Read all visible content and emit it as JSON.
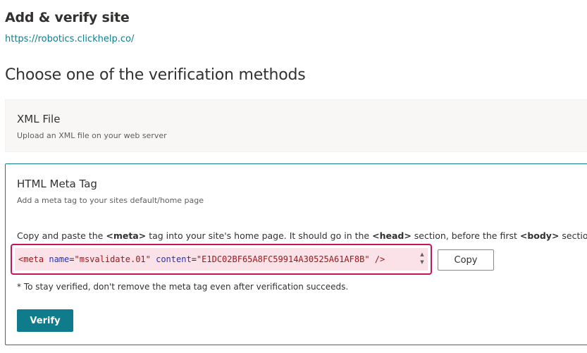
{
  "header": {
    "title": "Add & verify site",
    "site_url": "https://robotics.clickhelp.co/"
  },
  "verification": {
    "heading": "Choose one of the verification methods",
    "methods": [
      {
        "title": "XML File",
        "description": "Upload an XML file on your web server"
      },
      {
        "title": "HTML Meta Tag",
        "description": "Add a meta tag to your sites default/home page",
        "instruction_parts": {
          "p1": "Copy and paste the ",
          "b1": "<meta>",
          "p2": " tag into your site's home page. It should go in the ",
          "b2": "<head>",
          "p3": " section, before the first ",
          "b3": "<body>",
          "p4": " section."
        },
        "meta_tag": {
          "open": "<meta",
          "name_attr": "name",
          "name_value": "\"msvalidate.01\"",
          "content_attr": "content",
          "content_value": "\"E1DC02BF65A8FC59914A30525A61AF8B\"",
          "close": "/>"
        },
        "copy_label": "Copy",
        "note": "* To stay verified, don't remove the meta tag even after verification succeeds.",
        "verify_label": "Verify"
      }
    ]
  },
  "colors": {
    "accent": "#0f7c8c",
    "highlight_border": "#c8145a",
    "highlight_fill": "#fbe2e9"
  },
  "icons": {
    "scroll_up": "scroll-up-icon",
    "scroll_down": "scroll-down-icon"
  }
}
